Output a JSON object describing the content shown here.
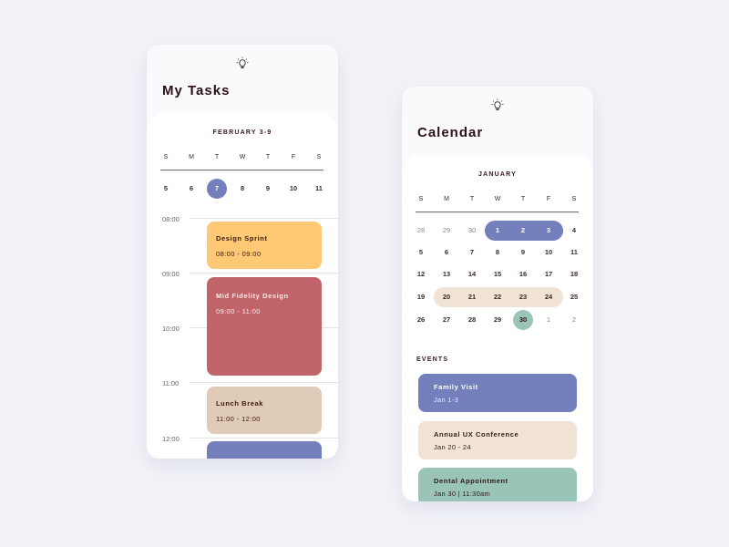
{
  "tasks_screen": {
    "title": "My Tasks",
    "icon": "lightbulb-icon",
    "week_label": "FEBRUARY 3-9",
    "weekdays": [
      "S",
      "M",
      "T",
      "W",
      "T",
      "F",
      "S"
    ],
    "days": [
      "5",
      "6",
      "7",
      "8",
      "9",
      "10",
      "11"
    ],
    "selected_day": "7",
    "hours": [
      "08:00",
      "09:00",
      "10:00",
      "11:00",
      "12:00"
    ],
    "tasks": [
      {
        "name": "Design Sprint",
        "time": "08:00 - 09:00",
        "color": "#fec974"
      },
      {
        "name": "Mid Fidelity Design",
        "time": "09:00 - 11:00",
        "color": "#c1646a"
      },
      {
        "name": "Lunch Break",
        "time": "11:00 - 12:00",
        "color": "#dfcbb7"
      },
      {
        "name": "",
        "time": "",
        "color": "#7380bb"
      }
    ]
  },
  "calendar_screen": {
    "title": "Calendar",
    "icon": "lightbulb-icon",
    "month_label": "JANUARY",
    "weekdays": [
      "S",
      "M",
      "T",
      "W",
      "T",
      "F",
      "S"
    ],
    "weeks": [
      [
        "28",
        "29",
        "30",
        "1",
        "2",
        "3",
        "4"
      ],
      [
        "5",
        "6",
        "7",
        "8",
        "9",
        "10",
        "11"
      ],
      [
        "12",
        "13",
        "14",
        "15",
        "16",
        "17",
        "18"
      ],
      [
        "19",
        "20",
        "21",
        "22",
        "23",
        "24",
        "25"
      ],
      [
        "26",
        "27",
        "28",
        "29",
        "30",
        "1",
        "2"
      ]
    ],
    "events_label": "EVENTS",
    "events": [
      {
        "name": "Family Visit",
        "date": "Jan 1-3",
        "color": "#7380bb"
      },
      {
        "name": "Annual UX Conference",
        "date": "Jan 20 - 24",
        "color": "#f1e3d5"
      },
      {
        "name": "Dental Appointment",
        "date": "Jan 30 | 11:30am",
        "color": "#9bc4b9"
      }
    ]
  }
}
